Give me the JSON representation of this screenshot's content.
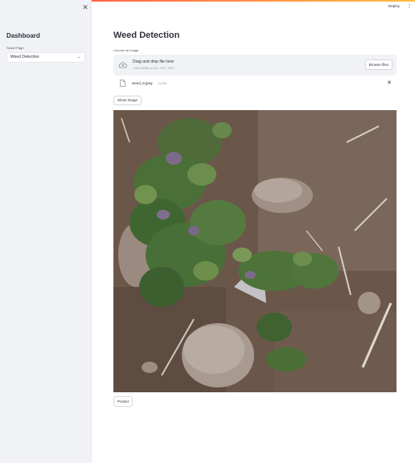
{
  "sidebar": {
    "title": "Dashboard",
    "select_label": "Select Page",
    "select_value": "Weed Detection"
  },
  "header": {
    "deploy_label": "Deploy"
  },
  "main": {
    "title": "Weed Detection",
    "uploader_label": "Choose an image",
    "drop_main": "Drag and drop file here",
    "drop_sub": "Limit 200MB per file • JPG, JPEG",
    "browse_label": "Browse files",
    "file_name": "weed_8.jpeg",
    "file_size": "13.0KB",
    "show_label": "Show Image",
    "predict_label": "Predict"
  },
  "colors": {
    "accent": "#ff4b4b",
    "sidebar_bg": "#f0f2f6",
    "text": "#31333f"
  },
  "icons": {
    "close": "close-icon",
    "cloud_upload": "cloud-upload-icon",
    "file": "file-icon",
    "chevron": "chevron-down-icon",
    "menu": "kebab-menu-icon"
  }
}
